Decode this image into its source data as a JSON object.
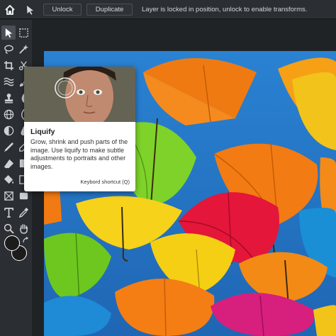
{
  "topbar": {
    "unlock_label": "Unlock",
    "duplicate_label": "Duplicate",
    "message": "Layer is locked in position, unlock to enable transforms."
  },
  "icons": {
    "home": "home-icon",
    "arrow": "arrow-icon"
  },
  "toolbar": {
    "tools": [
      "move",
      "marquee",
      "lasso",
      "magic-wand",
      "crop",
      "slice",
      "liquify",
      "brush",
      "stamp",
      "smudge",
      "globe",
      "blur",
      "dodge",
      "pen",
      "eraser",
      "shape",
      "fill",
      "gradient",
      "frame",
      "rectangle",
      "text",
      "eyedropper",
      "zoom",
      "hand"
    ],
    "colors": {
      "foreground": "#1c1c1c",
      "background": "#1c1c1c"
    }
  },
  "tooltip": {
    "title": "Liquify",
    "description": "Grow, shrink and push parts of the image. Use liquify to make subtle adjustments to portraits and other images.",
    "shortcut": "Keybord shortcut (Q)"
  },
  "colors": {
    "sky": "#2a78c8",
    "orange": "#f47a10",
    "green": "#66c81e",
    "yellow": "#f5cc10",
    "red": "#e8163c",
    "magenta": "#d81a78",
    "blue": "#1e8fd8"
  }
}
